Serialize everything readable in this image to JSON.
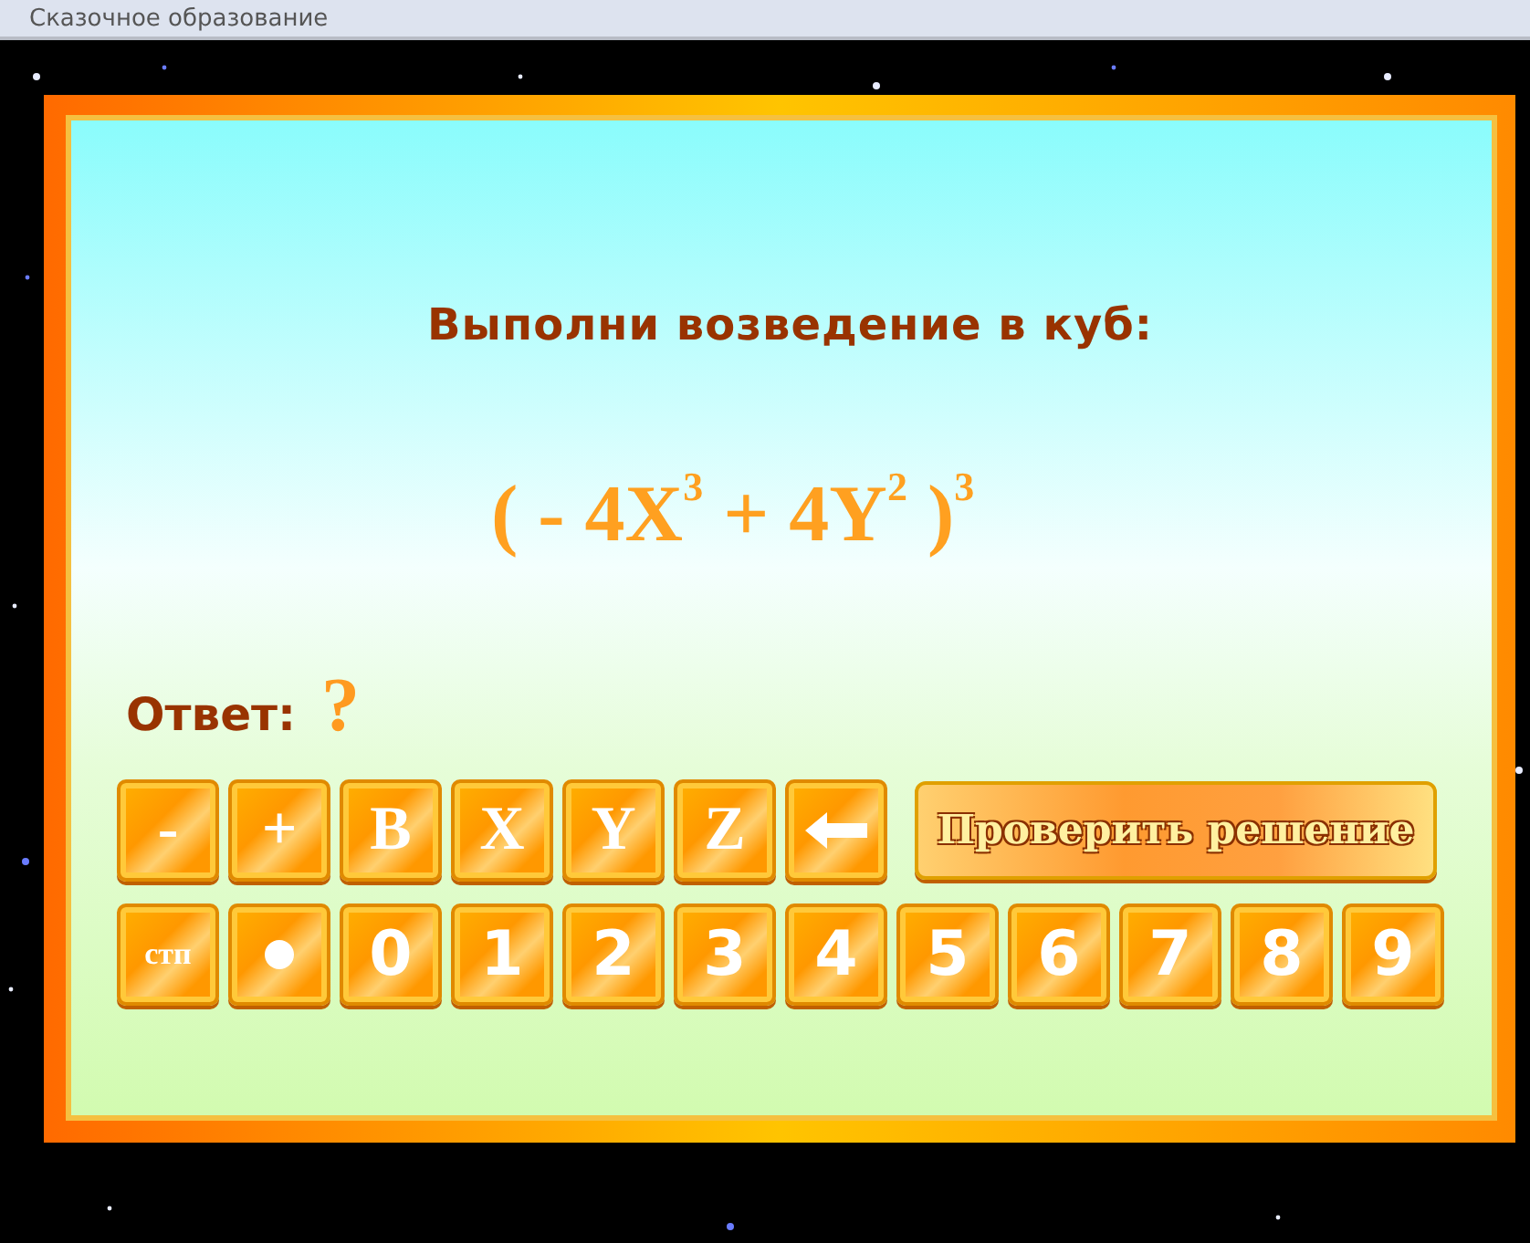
{
  "window": {
    "title": "Сказочное образование"
  },
  "task": {
    "prompt": "Выполни возведение в куб:",
    "expression": "( - 4X$^{3}$ + 4Y$^{2}$ )$^{3}$"
  },
  "answer": {
    "label": "Ответ:",
    "value": "?"
  },
  "keypad": {
    "rows": [
      [
        {
          "kind": "text",
          "label": "-"
        },
        {
          "kind": "text",
          "label": "+"
        },
        {
          "kind": "text",
          "label": "B"
        },
        {
          "kind": "text",
          "label": "X"
        },
        {
          "kind": "text",
          "label": "Y"
        },
        {
          "kind": "text",
          "label": "Z"
        },
        {
          "kind": "backspace"
        }
      ],
      [
        {
          "kind": "small",
          "label": "стп"
        },
        {
          "kind": "dot"
        },
        {
          "kind": "digit",
          "label": "0"
        },
        {
          "kind": "digit",
          "label": "1"
        },
        {
          "kind": "digit",
          "label": "2"
        },
        {
          "kind": "digit",
          "label": "3"
        },
        {
          "kind": "digit",
          "label": "4"
        },
        {
          "kind": "digit",
          "label": "5"
        },
        {
          "kind": "digit",
          "label": "6"
        },
        {
          "kind": "digit",
          "label": "7"
        },
        {
          "kind": "digit",
          "label": "8"
        },
        {
          "kind": "digit",
          "label": "9"
        }
      ]
    ]
  },
  "check_button": {
    "label": "Проверить решение"
  }
}
